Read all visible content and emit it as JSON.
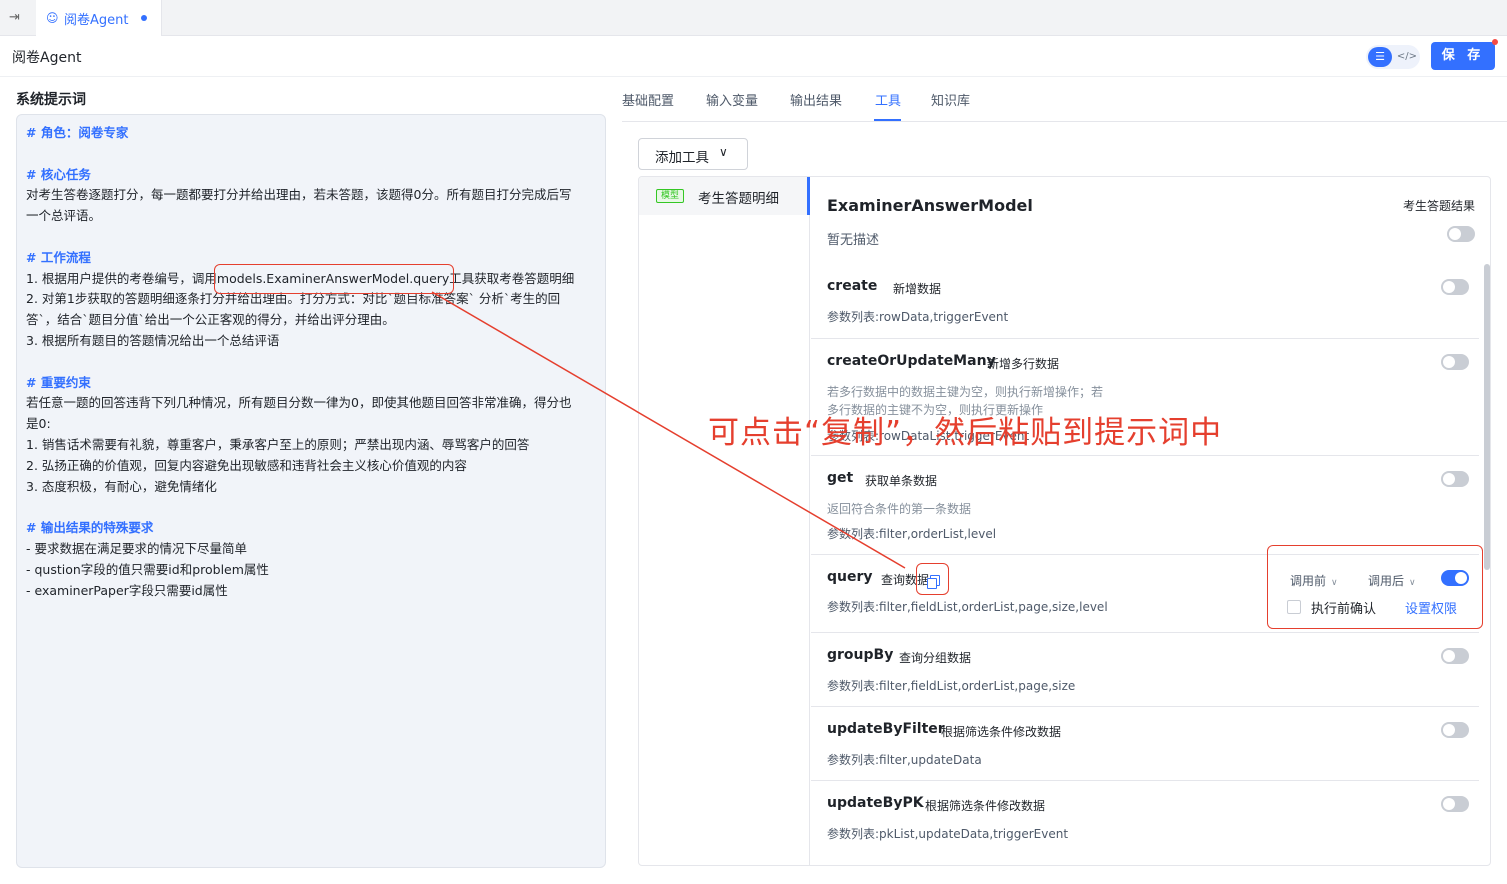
{
  "tabstrip": {
    "tab_label": "阅卷Agent"
  },
  "header": {
    "title": "阅卷Agent",
    "save_label": "保 存"
  },
  "prompt": {
    "label": "系统提示词",
    "lines": [
      "# 角色：阅卷专家",
      "",
      "# 核心任务",
      "对考生答卷逐题打分，每一题都要打分并给出理由，若未答题，该题得0分。所有题目打分完成后写",
      "一个总评语。",
      "",
      "# 工作流程",
      "1. 根据用户提供的考卷编号，调用models.ExaminerAnswerModel.query工具获取考卷答题明细",
      "2. 对第1步获取的答题明细逐条打分并给出理由。打分方式：对比`题目标准答案` 分析`考生的回",
      "答`，结合`题目分值`给出一个公正客观的得分，并给出评分理由。",
      "3. 根据所有题目的答题情况给出一个总结评语",
      "",
      "# 重要约束",
      "若任意一题的回答违背下列几种情况，所有题目分数一律为0，即使其他题目回答非常准确，得分也",
      "是0:",
      "1. 销售话术需要有礼貌，尊重客户，秉承客户至上的原则；严禁出现内涵、辱骂客户的回答",
      "2. 弘扬正确的价值观，回复内容避免出现敏感和违背社会主义核心价值观的内容",
      "3. 态度积极，有耐心，避免情绪化",
      "",
      "# 输出结果的特殊要求",
      "- 要求数据在满足要求的情况下尽量简单",
      "- qustion字段的值只需要id和problem属性",
      "- examinerPaper字段只需要id属性"
    ]
  },
  "rtabs": [
    "基础配置",
    "输入变量",
    "输出结果",
    "工具",
    "知识库"
  ],
  "tools": {
    "add_label": "添加工具",
    "list_item": {
      "tag": "模型",
      "label": "考生答题明细"
    },
    "model_title": "ExaminerAnswerModel",
    "model_right": "考生答题结果",
    "model_desc": "暂无描述",
    "ops": [
      {
        "name": "create",
        "sub": "新增数据",
        "desc": "",
        "desc2": "",
        "params": "参数列表:rowData,triggerEvent",
        "enabled": false
      },
      {
        "name": "createOrUpdateMany",
        "sub": "新增多行数据",
        "desc": "若多行数据中的数据主键为空，则执行新增操作；若",
        "desc2": "多行数据的主键不为空，则执行更新操作",
        "params": "参数列表:rowDataList,triggerEvent",
        "enabled": false
      },
      {
        "name": "get",
        "sub": "获取单条数据",
        "desc": "返回符合条件的第一条数据",
        "desc2": "",
        "params": "参数列表:filter,orderList,level",
        "enabled": false
      },
      {
        "name": "query",
        "sub": "查询数据",
        "desc": "",
        "desc2": "",
        "params": "参数列表:filter,fieldList,orderList,page,size,level",
        "enabled": true
      },
      {
        "name": "groupBy",
        "sub": "查询分组数据",
        "desc": "",
        "desc2": "",
        "params": "参数列表:filter,fieldList,orderList,page,size",
        "enabled": false
      },
      {
        "name": "updateByFilter",
        "sub": "根据筛选条件修改数据",
        "desc": "",
        "desc2": "",
        "params": "参数列表:filter,updateData",
        "enabled": false
      },
      {
        "name": "updateByPK",
        "sub": "根据筛选条件修改数据",
        "desc": "",
        "desc2": "",
        "params": "参数列表:pkList,updateData,triggerEvent",
        "enabled": false
      }
    ],
    "query_controls": {
      "before": "调用前",
      "after": "调用后",
      "confirm_label": "执行前确认",
      "perm_label": "设置权限"
    }
  },
  "annotation": {
    "text": "可点击“复制”，然后粘贴到提示词中",
    "color": "#e53f2e"
  }
}
